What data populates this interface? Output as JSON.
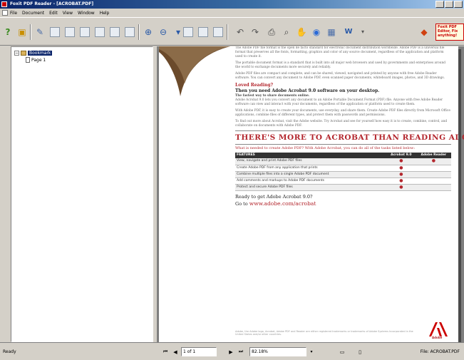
{
  "window": {
    "title": "Foxit PDF Reader - [ACROBAT.PDF]"
  },
  "menu": [
    "File",
    "Document",
    "Edit",
    "View",
    "Window",
    "Help"
  ],
  "toolbar": {
    "ad_text": "Foxit PDF Editor, Fix anything!"
  },
  "sidebar": {
    "root_label": "Bookmark",
    "child_label": "Page 1"
  },
  "document": {
    "para1": "The Adobe PDF file format is the open de facto standard for electronic document distribution worldwide. Adobe PDF is a universal file format that preserves all the fonts, formatting, graphics and color of any source document, regardless of the application and platform used to create it.",
    "para2": "The portable document format is a standard that is built into all major web browsers and used by governments and enterprises around the world to exchange documents more securely and reliably.",
    "para3": "Adobe PDF files are compact and complete, and can be shared, viewed, navigated and printed by anyone with free Adobe Reader software. You can convert any document to Adobe PDF, even scanned paper documents, whiteboard images, photos, and 3D drawings.",
    "section_red": "Loved Reading?",
    "section_sub": "Then you need Adobe Acrobat 9.0 software on your desktop.",
    "section_sub2": "The fastest way to share documents online.",
    "para4": "Adobe Acrobat 9.0 lets you convert any document to an Adobe Portable Document Format (PDF) file. Anyone with free Adobe Reader software can view and interact with your documents, regardless of the application or platform used to create them.",
    "para5": "With Adobe PDF, it is easy to create your documents, use everyday, and share them. Create Adobe PDF files directly from Microsoft Office applications, combine files of different types, and protect them with passwords and permissions.",
    "para6": "To find out more about Acrobat, visit the Adobe website. Try Acrobat and see for yourself how easy it is to create, combine, control, and collaborate on documents with Adobe PDF.",
    "big_heading": "THERE'S MORE TO ACROBAT THAN READING ADOBE PDF FILES!",
    "red_line": "What is needed to create Adobe PDF? With Adobe Acrobat, you can do all of the tasks listed below:",
    "table_header": [
      "FEATURES",
      "Acrobat 9.0",
      "Adobe Reader"
    ],
    "table_rows": [
      [
        "View, navigate and print Adobe PDF files",
        "●",
        "●"
      ],
      [
        "Create Adobe PDF from any application that prints",
        "●",
        ""
      ],
      [
        "Combine multiple files into a single Adobe PDF document",
        "●",
        ""
      ],
      [
        "Add comments and markups to Adobe PDF documents",
        "●",
        ""
      ],
      [
        "Protect and secure Adobe PDF files",
        "●",
        ""
      ]
    ],
    "ready_line1": "Ready to get Adobe Acrobat 9.0?",
    "ready_line2": "Go to",
    "url": "www.adobe.com/acrobat",
    "fine_print": "Adobe, the Adobe logo, Acrobat, Adobe PDF and Reader are either registered trademarks or trademarks of Adobe Systems Incorporated in the United States and/or other countries.",
    "logo_text": "Adobe"
  },
  "status": {
    "left": "Ready",
    "page_field": "1 of 1",
    "zoom": "82.18%",
    "file": "File: ACROBAT.PDF"
  }
}
